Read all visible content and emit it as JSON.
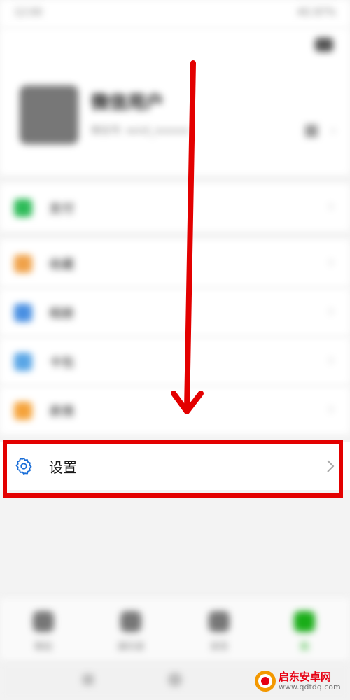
{
  "status_bar": {
    "time": "12:00",
    "right": "4G 87%"
  },
  "profile": {
    "nickname": "微信用户",
    "wechat_id": "微信号: wxid_xxxxxx"
  },
  "menu": [
    {
      "label": "支付",
      "icon": "pay-icon",
      "color": "#2dbb58"
    },
    {
      "label": "收藏",
      "icon": "favorites-icon",
      "color": "#f0a24a"
    },
    {
      "label": "相册",
      "icon": "album-icon",
      "color": "#4a90e2"
    },
    {
      "label": "卡包",
      "icon": "cards-icon",
      "color": "#5aa6e6"
    },
    {
      "label": "表情",
      "icon": "stickers-icon",
      "color": "#f5a33b"
    }
  ],
  "settings": {
    "label": "设置"
  },
  "bottom_nav": {
    "tabs": [
      {
        "label": "微信"
      },
      {
        "label": "通讯录"
      },
      {
        "label": "发现"
      },
      {
        "label": "我"
      }
    ]
  },
  "watermark": {
    "name": "启东安卓网",
    "url": "www.qdtdq.com"
  },
  "colors": {
    "accent_red": "#e30000",
    "gear_blue": "#1a6ed8",
    "brand_green": "#1aad19"
  }
}
